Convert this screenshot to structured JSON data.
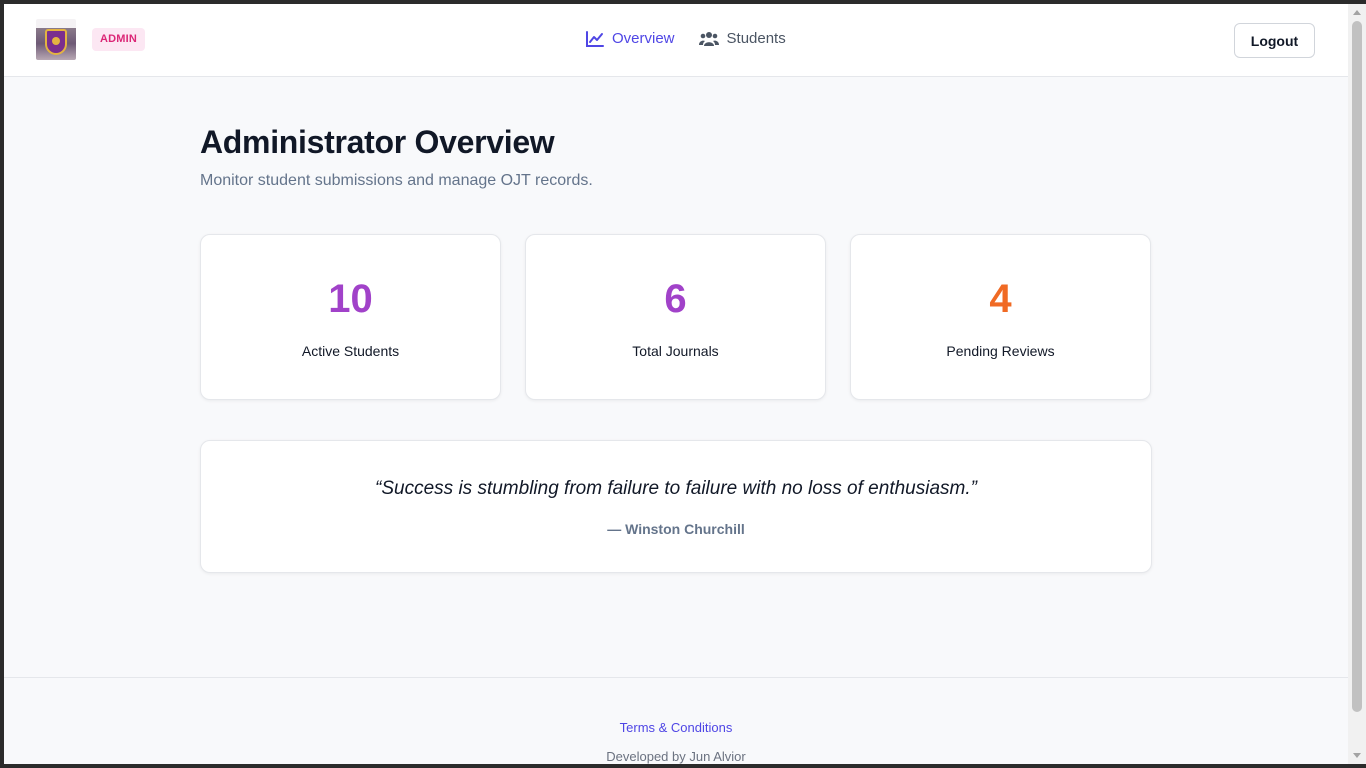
{
  "header": {
    "badge": "ADMIN",
    "nav": [
      {
        "label": "Overview",
        "icon": "chart-line-icon",
        "active": true
      },
      {
        "label": "Students",
        "icon": "users-icon",
        "active": false
      }
    ],
    "logout_label": "Logout"
  },
  "main": {
    "title": "Administrator Overview",
    "subtitle": "Monitor student submissions and manage OJT records.",
    "stats": [
      {
        "value": "10",
        "label": "Active Students",
        "color": "#a142c9"
      },
      {
        "value": "6",
        "label": "Total Journals",
        "color": "#a142c9"
      },
      {
        "value": "4",
        "label": "Pending Reviews",
        "color": "#f06a24"
      }
    ],
    "quote": {
      "text": "“Success is stumbling from failure to failure with no loss of enthusiasm.”",
      "author": "— Winston Churchill"
    }
  },
  "footer": {
    "terms": "Terms & Conditions",
    "credit": "Developed by Jun Alvior"
  },
  "colors": {
    "accent": "#4f46e5",
    "badge_bg": "#fce7f3",
    "badge_text": "#db2777"
  }
}
